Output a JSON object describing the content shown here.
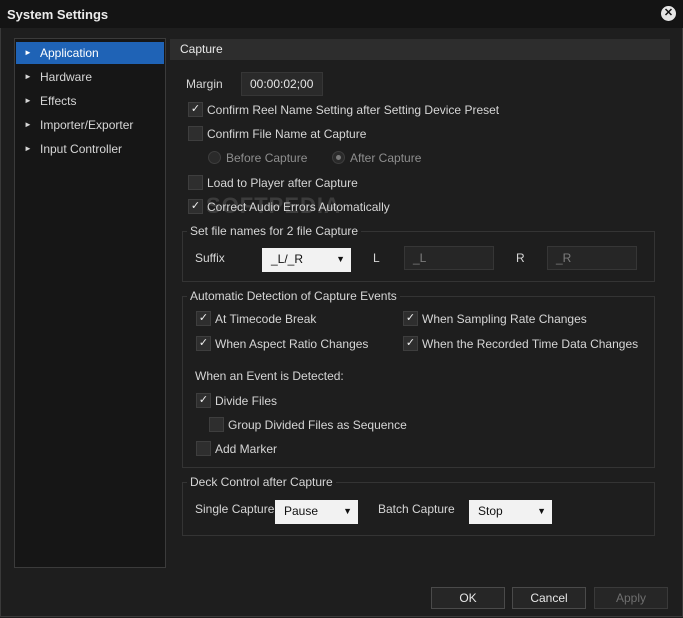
{
  "window": {
    "title": "System Settings",
    "close_glyph": "✕"
  },
  "sidebar": {
    "items": [
      {
        "label": "Application",
        "active": true
      },
      {
        "label": "Hardware"
      },
      {
        "label": "Effects"
      },
      {
        "label": "Importer/Exporter"
      },
      {
        "label": "Input Controller"
      }
    ],
    "arrow_glyph": "►"
  },
  "section": {
    "title": "Capture"
  },
  "margin": {
    "label": "Margin",
    "value": "00:00:02;00"
  },
  "options": {
    "confirm_reel": {
      "label": "Confirm Reel Name Setting after Setting Device Preset",
      "checked": true
    },
    "confirm_file": {
      "label": "Confirm File Name at Capture",
      "checked": false
    },
    "before_capture": {
      "label": "Before Capture",
      "selected": false
    },
    "after_capture": {
      "label": "After Capture",
      "selected": true
    },
    "load_player": {
      "label": "Load to Player after Capture",
      "checked": false
    },
    "correct_audio": {
      "label": "Correct Audio Errors Automatically",
      "checked": true
    }
  },
  "file_names": {
    "title": "Set file names for 2 file Capture",
    "suffix_label": "Suffix",
    "suffix_value": "_L/_R",
    "l_label": "L",
    "l_value": "_L",
    "r_label": "R",
    "r_value": "_R"
  },
  "auto_detect": {
    "title": "Automatic Detection of Capture Events",
    "timecode_break": {
      "label": "At Timecode Break",
      "checked": true
    },
    "sampling_rate": {
      "label": "When Sampling Rate Changes",
      "checked": true
    },
    "aspect_ratio": {
      "label": "When Aspect Ratio Changes",
      "checked": true
    },
    "recorded_time": {
      "label": "When the Recorded Time Data Changes",
      "checked": true
    },
    "event_label": "When an Event is Detected:",
    "divide_files": {
      "label": "Divide Files",
      "checked": true
    },
    "group_divided": {
      "label": "Group Divided Files as Sequence",
      "checked": false
    },
    "add_marker": {
      "label": "Add Marker",
      "checked": false
    }
  },
  "deck_control": {
    "title": "Deck Control after Capture",
    "single_label": "Single Capture",
    "single_value": "Pause",
    "batch_label": "Batch Capture",
    "batch_value": "Stop"
  },
  "buttons": {
    "ok": "OK",
    "cancel": "Cancel",
    "apply": "Apply"
  },
  "watermark": "SOFTPEDIA",
  "colors": {
    "accent": "#1f63b6",
    "background": "#1e1e1e"
  },
  "glyphs": {
    "check": "✓",
    "caret": "▼"
  }
}
